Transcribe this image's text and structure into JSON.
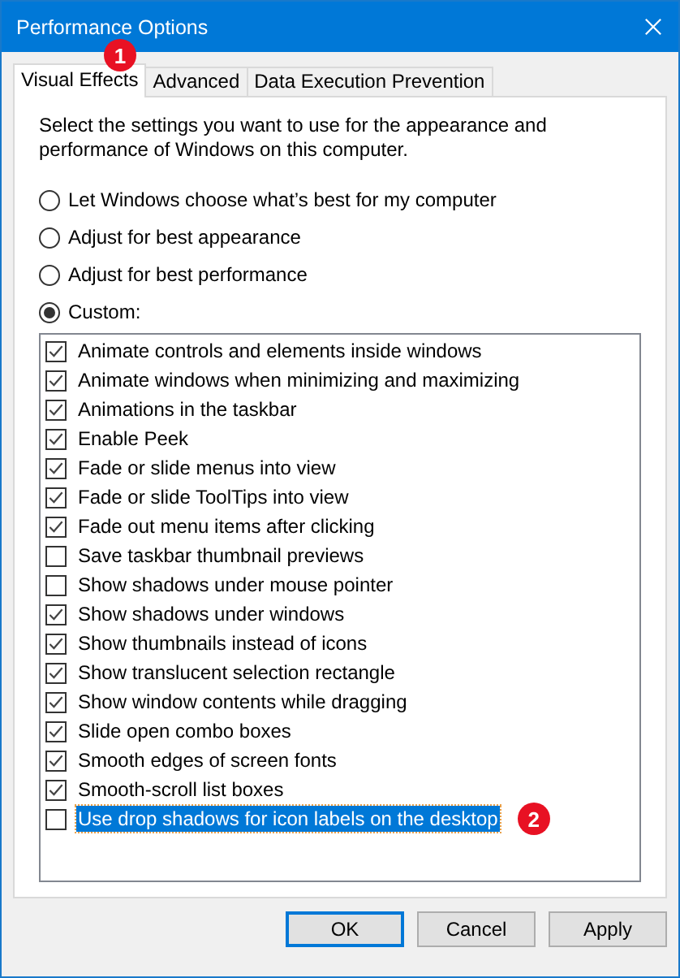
{
  "window": {
    "title": "Performance Options"
  },
  "tabs": [
    {
      "label": "Visual Effects",
      "selected": true,
      "badge": "1"
    },
    {
      "label": "Advanced",
      "selected": false
    },
    {
      "label": "Data Execution Prevention",
      "selected": false
    }
  ],
  "description": "Select the settings you want to use for the appearance and performance of Windows on this computer.",
  "options": [
    {
      "label": "Let Windows choose what’s best for my computer",
      "selected": false
    },
    {
      "label": "Adjust for best appearance",
      "selected": false
    },
    {
      "label": "Adjust for best performance",
      "selected": false
    },
    {
      "label": "Custom:",
      "selected": true
    }
  ],
  "effects": [
    {
      "label": "Animate controls and elements inside windows",
      "checked": true,
      "selected": false
    },
    {
      "label": "Animate windows when minimizing and maximizing",
      "checked": true,
      "selected": false
    },
    {
      "label": "Animations in the taskbar",
      "checked": true,
      "selected": false
    },
    {
      "label": "Enable Peek",
      "checked": true,
      "selected": false
    },
    {
      "label": "Fade or slide menus into view",
      "checked": true,
      "selected": false
    },
    {
      "label": "Fade or slide ToolTips into view",
      "checked": true,
      "selected": false
    },
    {
      "label": "Fade out menu items after clicking",
      "checked": true,
      "selected": false
    },
    {
      "label": "Save taskbar thumbnail previews",
      "checked": false,
      "selected": false
    },
    {
      "label": "Show shadows under mouse pointer",
      "checked": false,
      "selected": false
    },
    {
      "label": "Show shadows under windows",
      "checked": true,
      "selected": false
    },
    {
      "label": "Show thumbnails instead of icons",
      "checked": true,
      "selected": false
    },
    {
      "label": "Show translucent selection rectangle",
      "checked": true,
      "selected": false
    },
    {
      "label": "Show window contents while dragging",
      "checked": true,
      "selected": false
    },
    {
      "label": "Slide open combo boxes",
      "checked": true,
      "selected": false
    },
    {
      "label": "Smooth edges of screen fonts",
      "checked": true,
      "selected": false
    },
    {
      "label": "Smooth-scroll list boxes",
      "checked": true,
      "selected": false
    },
    {
      "label": "Use drop shadows for icon labels on the desktop",
      "checked": false,
      "selected": true,
      "badge": "2"
    }
  ],
  "buttons": [
    {
      "label": "OK",
      "default": true
    },
    {
      "label": "Cancel",
      "default": false
    },
    {
      "label": "Apply",
      "default": false
    }
  ]
}
